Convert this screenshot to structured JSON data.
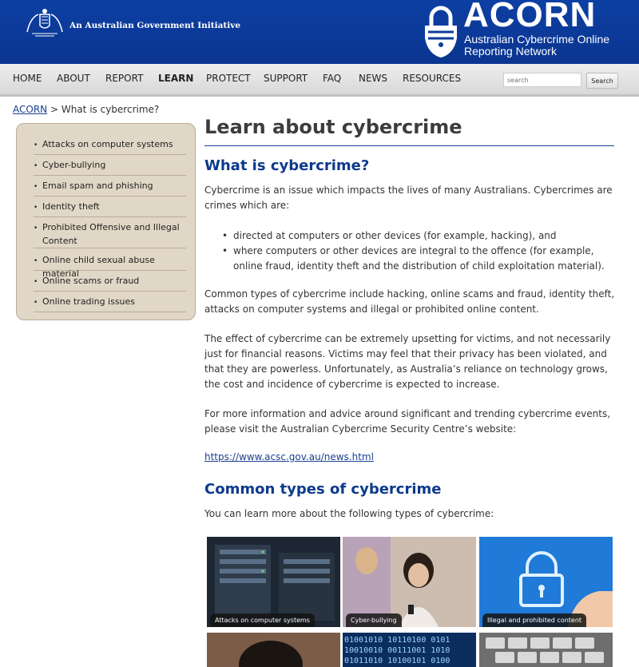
{
  "header": {
    "gov_initiative": "An Australian Government Initiative",
    "brand": "ACORN",
    "brand_subtitle": "Australian Cybercrime Online Reporting Network",
    "colors": {
      "header_bg": "#0c3c9a",
      "accent": "#0d3a8c",
      "sidebar_bg": "#e1d7c6"
    }
  },
  "nav": {
    "items": [
      "HOME",
      "ABOUT",
      "REPORT",
      "LEARN",
      "PROTECT",
      "SUPPORT",
      "FAQ",
      "NEWS",
      "RESOURCES"
    ],
    "active": "LEARN",
    "search_placeholder": "search",
    "search_button": "Search"
  },
  "breadcrumb": {
    "root": "ACORN",
    "separator": ">",
    "current": "What is cybercrime?"
  },
  "sidebar": {
    "items": [
      "Attacks on computer systems",
      "Cyber-bullying",
      "Email spam and phishing",
      "Identity theft",
      "Prohibited Offensive and Illegal Content",
      "Online child sexual abuse material",
      "Online scams or fraud",
      "Online trading issues"
    ]
  },
  "main": {
    "title": "Learn about cybercrime",
    "section1_heading": "What is cybercrime?",
    "intro": "Cybercrime is an issue which impacts the lives of many Australians. Cybercrimes are crimes which are:",
    "bullets": [
      "directed at computers or other devices (for example, hacking), and",
      "where computers or other devices are integral to the offence (for example, online fraud, identity theft and the distribution of child exploitation material)."
    ],
    "para_common": "Common types of cybercrime include hacking, online scams and fraud, identity theft, attacks on computer systems and illegal or prohibited online content.",
    "para_effect": "The effect of cybercrime can be extremely upsetting for victims, and not necessarily just for financial reasons. Victims may feel that their privacy has been violated, and that they are powerless. Unfortunately, as Australia’s reliance on technology grows, the cost and incidence of cybercrime is expected to increase.",
    "para_more": "For more information and advice around significant and trending cybercrime events, please visit the Australian Cybercrime Security Centre’s website:",
    "link": "https://www.acsc.gov.au/news.html",
    "section2_heading": "Common types of cybercrime",
    "section2_intro": "You can learn more about the following types of cybercrime:"
  },
  "tiles": [
    {
      "caption": "Attacks on computer systems",
      "icon": "server-rack-image"
    },
    {
      "caption": "Cyber-bullying",
      "icon": "girl-with-phone-image"
    },
    {
      "caption": "Illegal and prohibited content",
      "icon": "padlock-image"
    },
    {
      "caption": "",
      "icon": "child-image"
    },
    {
      "caption": "",
      "icon": "binary-code-image"
    },
    {
      "caption": "",
      "icon": "keyboard-image"
    }
  ]
}
